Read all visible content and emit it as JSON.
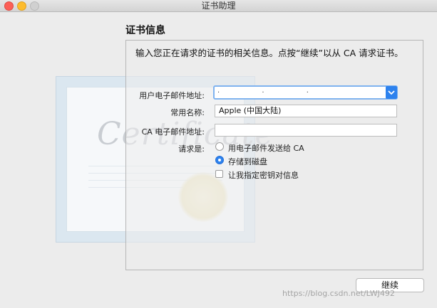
{
  "window": {
    "title": "证书助理"
  },
  "section": {
    "heading": "证书信息"
  },
  "description": "输入您正在请求的证书的相关信息。点按“继续”以从 CA 请求证书。",
  "form": {
    "email_label": "用户电子邮件地址:",
    "email_value_masked": "· · ·",
    "name_label": "常用名称:",
    "name_value": "Apple (中国大陆)",
    "ca_email_label": "CA 电子邮件地址:",
    "ca_email_value": "",
    "request_label": "请求是:",
    "options": [
      {
        "label": "用电子邮件发送给 CA",
        "selected": false
      },
      {
        "label": "存储到磁盘",
        "selected": true
      }
    ],
    "specify_key_label": "让我指定密钥对信息",
    "specify_key_checked": false
  },
  "buttons": {
    "continue": "继续"
  },
  "certificate_art": {
    "script_text": "Certificate"
  },
  "watermark": "https://blog.csdn.net/LWJ492",
  "colors": {
    "accent": "#2d82ee",
    "window_bg": "#ececec"
  }
}
